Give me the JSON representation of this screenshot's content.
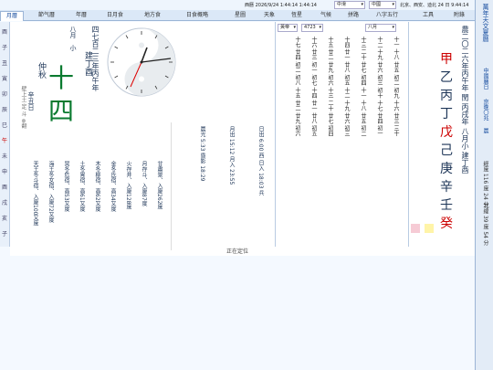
{
  "topbar": {
    "datetime": "西曆 2026/9/24  1:44:14  1:44:14",
    "region_select": "中滑",
    "country_select": "中國",
    "location": "北京、西安、迪北 24 日 9:44:14"
  },
  "tabs": [
    "月曆",
    "節气曆",
    "年曆",
    "日月食",
    "地方食",
    "日食概略",
    "星圖",
    "天象",
    "恆星",
    "气候",
    "拼路",
    "八字五行",
    "工具",
    "附錄"
  ],
  "branches": [
    "酉",
    "子",
    "丑",
    "寅",
    "卯",
    "辰",
    "巳",
    "午",
    "未",
    "申",
    "酉",
    "戌",
    "亥",
    "子"
  ],
  "big_day": {
    "month_line": "八月　小",
    "big_numerals": [
      "十",
      "四"
    ],
    "date_vertical": "四七百二三年丙午年",
    "ganzhi_month": "建丁酉",
    "festival": "仲秋",
    "day_gz": "辛丑日",
    "note": "壁上土 定 斗 ⊗翻"
  },
  "almanac": {
    "cols": [
      "甘肅景、入廈262度",
      "月存斗、入廈87度",
      "火存井、入廈128度",
      "金冬氐宿、高34又度",
      "木冬柳宿、高62又度",
      "土冬胃宿、高61又度",
      "冥冬危宿、高53又度",
      "海王冬女宿、入廈72又度",
      "天王冬斗宿、入廈100又度"
    ],
    "times": [
      "日出 6:00 西 日入 18:03 兵",
      "月出 15:12 月入 23:55",
      "晨光 5:33 昏影 18:29"
    ]
  },
  "right_header": {
    "year_select": "黃帝",
    "year_num": "4723",
    "month_select": "八月",
    "vertical_info": "農二〇二六年丙午年 閏 丙戌年 八月小 建丁酉",
    "sidebar_title": "萬年天文夏曆",
    "sidebar_links": [
      "中國曆日",
      "京晚〇兆",
      "晨",
      "經度 116 度 24 分",
      "北緯 39 度 54 分"
    ]
  },
  "stems_big": [
    "甲",
    "乙",
    "丙",
    "丁",
    "戊",
    "己",
    "庚",
    "辛",
    "壬",
    "癸"
  ],
  "stem_colors": [
    "red",
    "ink",
    "ink",
    "ink",
    "red",
    "ink",
    "ink",
    "ink",
    "ink",
    "red"
  ],
  "calendar_rows": [
    [
      "十一",
      "十八",
      "廿五",
      "初二",
      "初九",
      "十六",
      "廿三",
      "三十"
    ],
    [
      "十二",
      "十九",
      "廿六",
      "初三",
      "初十",
      "十七",
      "廿四",
      "初一"
    ],
    [
      "十三",
      "二十",
      "廿七",
      "初四",
      "十一",
      "十八",
      "廿五",
      "初二"
    ],
    [
      "十四",
      "廿一",
      "廿八",
      "初五",
      "十二",
      "十九",
      "廿六",
      "初三"
    ],
    [
      "十五",
      "廿二",
      "廿九",
      "初六",
      "十三",
      "二十",
      "廿七",
      "初四"
    ],
    [
      "十六",
      "廿三",
      "初一",
      "初七",
      "十四",
      "廿一",
      "廿八",
      "初五"
    ],
    [
      "十七",
      "廿四",
      "初二",
      "初八",
      "十五",
      "廿二",
      "廿九",
      "初六"
    ]
  ],
  "colors": {
    "accent": "#1a4fa0",
    "red": "#cc0000",
    "green": "#0a7a2f"
  },
  "status": "正在定位"
}
